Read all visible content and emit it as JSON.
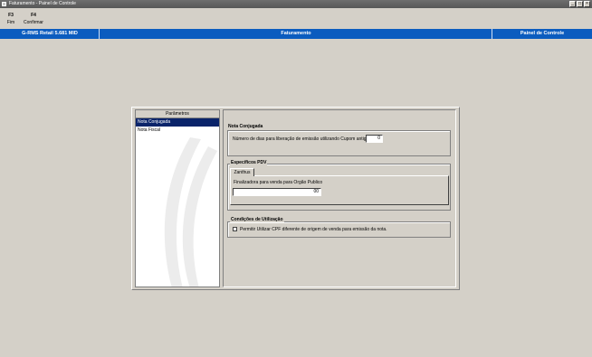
{
  "window": {
    "title": "Faturamento - Painel de Controle",
    "buttons": [
      "_",
      "□",
      "×"
    ]
  },
  "toolbar": {
    "keys": [
      {
        "key": "F3",
        "label": "Fim"
      },
      {
        "key": "F4",
        "label": "Confirmar"
      }
    ]
  },
  "header_bar": {
    "app": "G-RMS Retail 5.681 MID",
    "module": "Faturamento",
    "screen": "Painel de Controle",
    "color": "#0b5cbf"
  },
  "parametros": {
    "title": "Parâmetros",
    "items": [
      {
        "label": "Nota Conjugada",
        "selected": true
      },
      {
        "label": "Nota Fiscal",
        "selected": false
      }
    ]
  },
  "nota_conjugada": {
    "title": "Nota Conjugada",
    "dias_label": "Número de dias para liberação de emissão utilizando Cupom antigo:",
    "dias_value": "0"
  },
  "especificos_pdv": {
    "title": "Específicos PDV",
    "tab": "Zanthus",
    "finalizadora_label": "Finalizadora para venda para Orgão Publico",
    "finalizadora_value": "00"
  },
  "condicoes": {
    "title": "Condições de Utilização",
    "checkbox_label": "Permitir Utilizar CPF diferente de origem de venda para emissão da nota.",
    "checked": false
  }
}
